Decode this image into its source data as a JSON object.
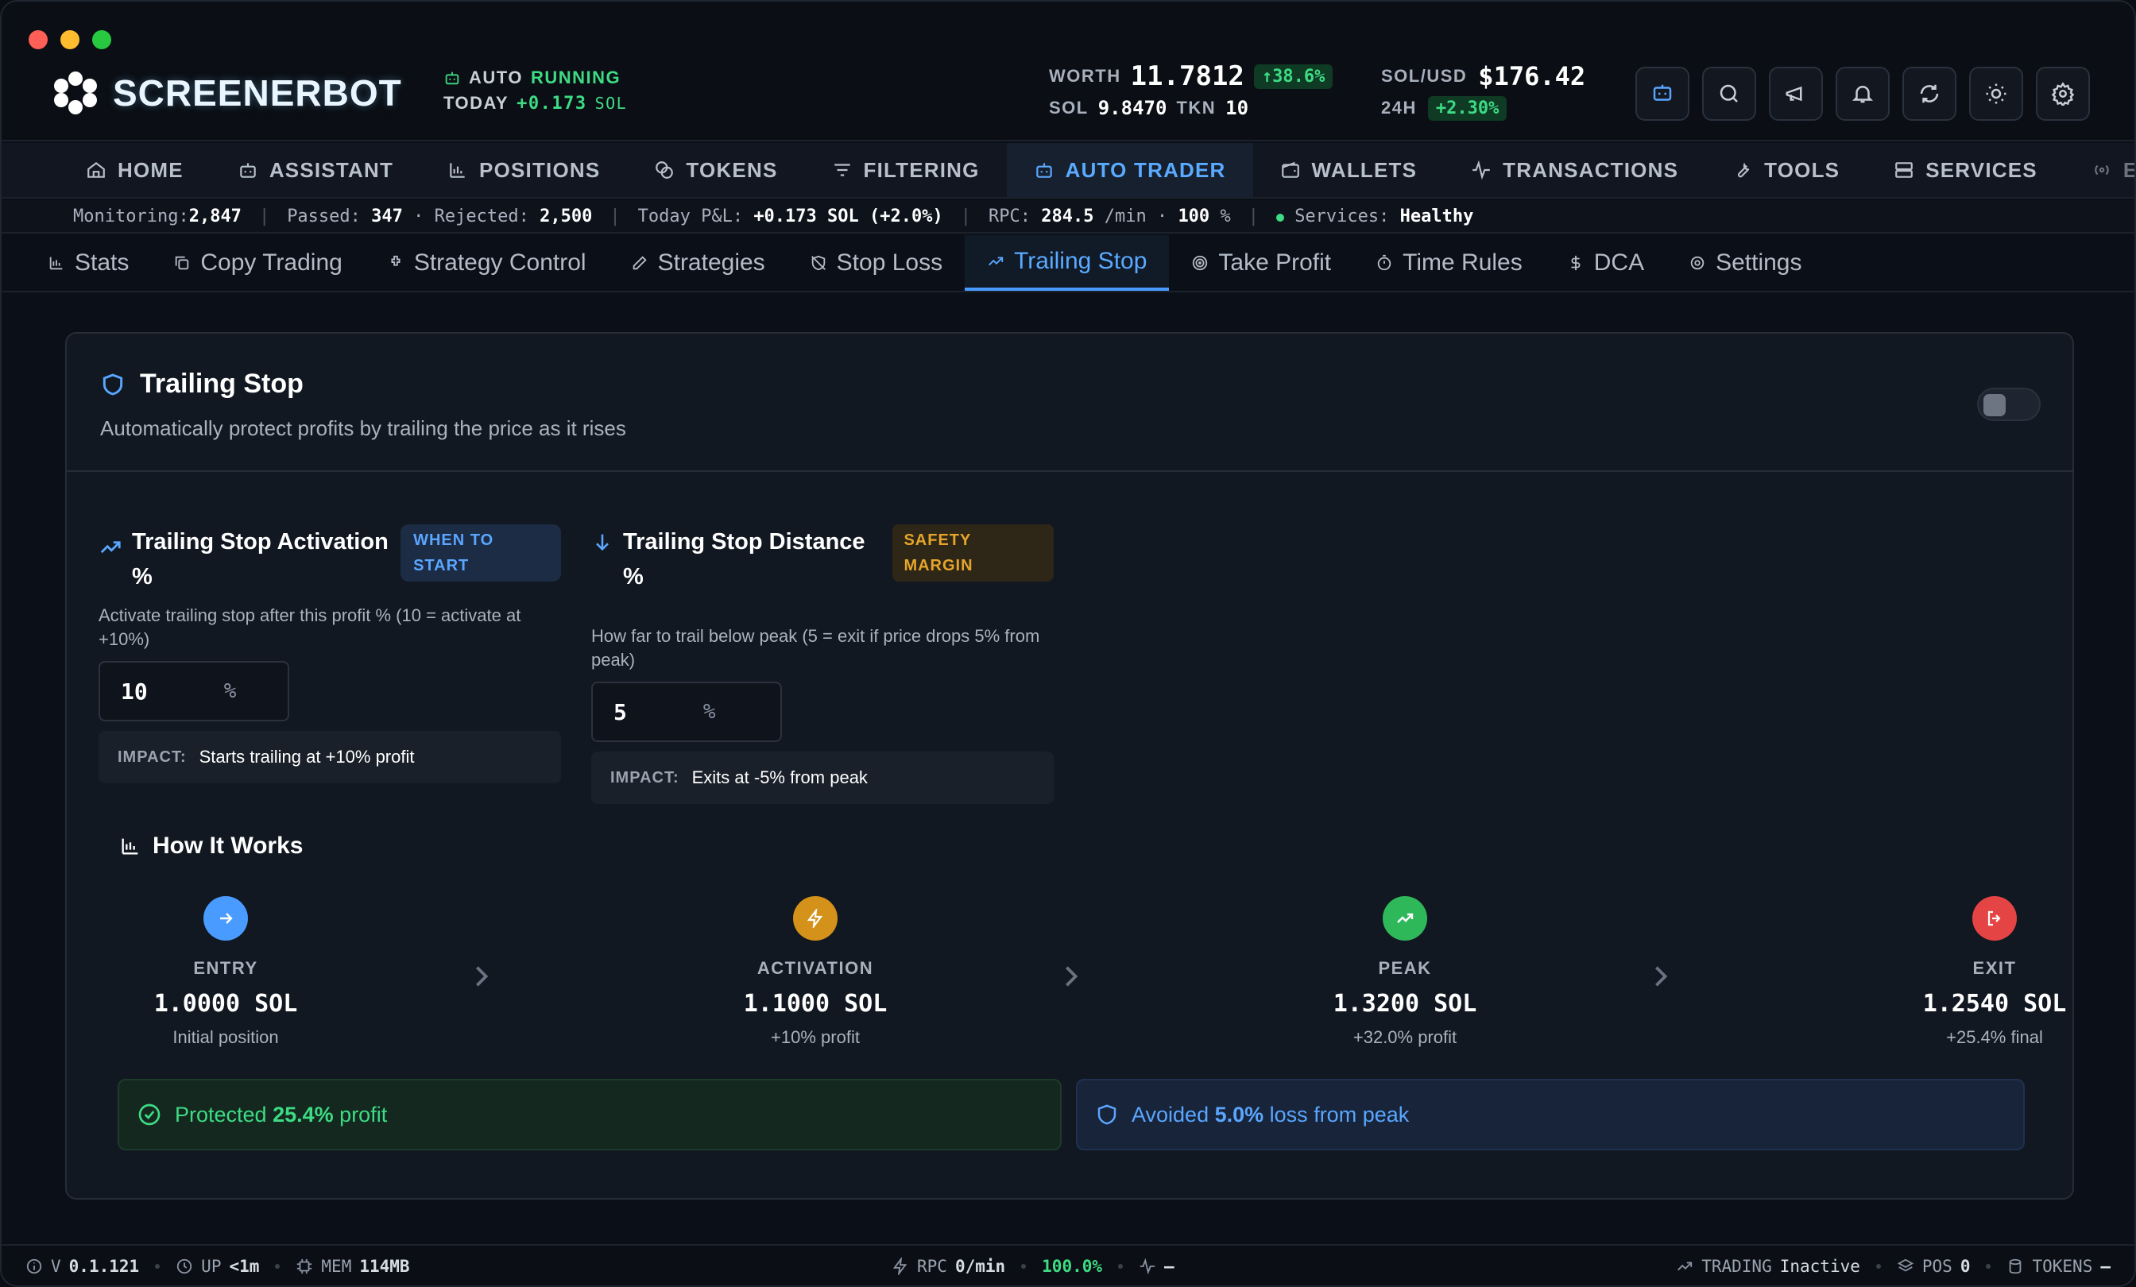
{
  "app": {
    "logo_text": "SCREENERBOT",
    "auto_label": "AUTO",
    "auto_status": "RUNNING",
    "today_label": "TODAY",
    "today_value": "+0.173",
    "today_unit": "SOL"
  },
  "wallet": {
    "worth_label": "WORTH",
    "worth_value": "11.7812",
    "worth_change": "↑38.6%",
    "sol_label": "SOL",
    "sol_value": "9.8470",
    "tkn_label": "TKN",
    "tkn_value": "10"
  },
  "price": {
    "pair_label": "SOL/USD",
    "pair_value": "$176.42",
    "h24_label": "24H",
    "h24_value": "+2.30%"
  },
  "header_icons": [
    "assistant-icon",
    "search-icon",
    "megaphone-icon",
    "bell-icon",
    "refresh-icon",
    "sun-icon",
    "gear-icon"
  ],
  "nav": {
    "items": [
      {
        "label": "HOME",
        "icon": "home-icon"
      },
      {
        "label": "ASSISTANT",
        "icon": "bot-icon"
      },
      {
        "label": "POSITIONS",
        "icon": "chart-icon"
      },
      {
        "label": "TOKENS",
        "icon": "coins-icon"
      },
      {
        "label": "FILTERING",
        "icon": "filter-icon"
      },
      {
        "label": "AUTO TRADER",
        "icon": "bot-icon",
        "active": true
      },
      {
        "label": "WALLETS",
        "icon": "wallet-icon"
      },
      {
        "label": "TRANSACTIONS",
        "icon": "activity-icon"
      },
      {
        "label": "TOOLS",
        "icon": "wrench-icon"
      },
      {
        "label": "SERVICES",
        "icon": "server-icon"
      },
      {
        "label": "EVE",
        "icon": "radio-icon"
      }
    ]
  },
  "status_strip": {
    "monitoring_label": "Monitoring:",
    "monitoring_value": "2,847",
    "passed_label": "Passed:",
    "passed_value": "347",
    "rejected_label": "Rejected:",
    "rejected_value": "2,500",
    "pnl_label": "Today P&L:",
    "pnl_value": "+0.173 SOL (+2.0%)",
    "rpc_label": "RPC:",
    "rpc_value": "284.5",
    "rpc_unit": "/min",
    "rpc_pct": "100",
    "rpc_pct_unit": "%",
    "services_label": "Services:",
    "services_value": "Healthy"
  },
  "subtabs": [
    {
      "label": "Stats",
      "icon": "stats-icon"
    },
    {
      "label": "Copy Trading",
      "icon": "copy-icon"
    },
    {
      "label": "Strategy Control",
      "icon": "puzzle-icon"
    },
    {
      "label": "Strategies",
      "icon": "edit-icon"
    },
    {
      "label": "Stop Loss",
      "icon": "shield-off-icon"
    },
    {
      "label": "Trailing Stop",
      "icon": "trending-up-icon",
      "active": true
    },
    {
      "label": "Take Profit",
      "icon": "target-icon"
    },
    {
      "label": "Time Rules",
      "icon": "timer-icon"
    },
    {
      "label": "DCA",
      "icon": "dollar-icon"
    },
    {
      "label": "Settings",
      "icon": "gear-icon"
    }
  ],
  "card": {
    "title": "Trailing Stop",
    "subtitle": "Automatically protect profits by trailing the price as it rises",
    "enabled": false
  },
  "activation": {
    "title": "Trailing Stop Activation %",
    "badge": "WHEN TO START",
    "description": "Activate trailing stop after this profit % (10 = activate at +10%)",
    "value": "10",
    "unit": "%",
    "impact_label": "IMPACT:",
    "impact_value": "Starts trailing at +10% profit"
  },
  "distance": {
    "title": "Trailing Stop Distance %",
    "badge": "SAFETY MARGIN",
    "description": "How far to trail below peak (5 = exit if price drops 5% from peak)",
    "value": "5",
    "unit": "%",
    "impact_label": "IMPACT:",
    "impact_value": "Exits at -5% from peak"
  },
  "how": {
    "title": "How It Works",
    "steps": [
      {
        "label": "ENTRY",
        "value": "1.0000 SOL",
        "note": "Initial position",
        "color": "#4a9bff"
      },
      {
        "label": "ACTIVATION",
        "value": "1.1000 SOL",
        "note": "+10% profit",
        "color": "#d4921a"
      },
      {
        "label": "PEAK",
        "value": "1.3200 SOL",
        "note": "+32.0% profit",
        "color": "#2fb85a"
      },
      {
        "label": "EXIT",
        "value": "1.2540 SOL",
        "note": "+25.4% final",
        "color": "#e54444"
      }
    ]
  },
  "results": {
    "protected_pre": "Protected",
    "protected_value": "25.4%",
    "protected_post": "profit",
    "avoided_pre": "Avoided",
    "avoided_value": "5.0%",
    "avoided_post": "loss from peak"
  },
  "footer": {
    "version_label": "V",
    "version_value": "0.1.121",
    "up_label": "UP",
    "up_value": "<1m",
    "mem_label": "MEM",
    "mem_value": "114MB",
    "rpc_label": "RPC",
    "rpc_value": "0/min",
    "rpc_pct": "100.0%",
    "activity_value": "–",
    "trading_label": "TRADING",
    "trading_value": "Inactive",
    "pos_label": "POS",
    "pos_value": "0",
    "tokens_label": "TOKENS",
    "tokens_value": "–"
  }
}
